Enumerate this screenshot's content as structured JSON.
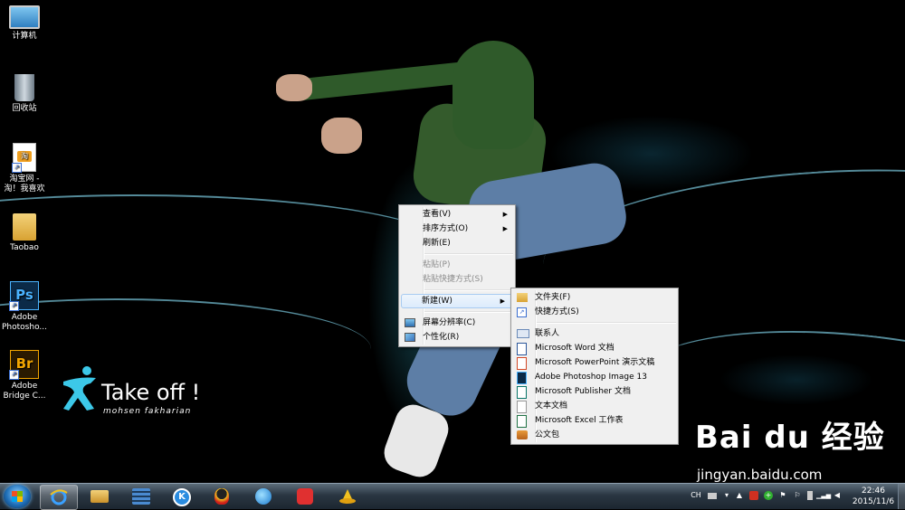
{
  "desktop_icons": [
    {
      "label": "计算机",
      "icon": "computer-icon"
    },
    {
      "label": "回收站",
      "icon": "recycle-bin-icon"
    },
    {
      "label": "淘宝网 - 淘！我喜欢",
      "icon": "taobao-shortcut-icon",
      "badge": "淘"
    },
    {
      "label": "Taobao",
      "icon": "folder-icon"
    },
    {
      "label": "Adobe Photosho...",
      "icon": "photoshop-icon",
      "badge": "Ps"
    },
    {
      "label": "Adobe Bridge C...",
      "icon": "bridge-icon",
      "badge": "Br"
    }
  ],
  "logo": {
    "title": "Take off !",
    "subtitle": "mohsen fakharian"
  },
  "context_menu": {
    "view": "查看(V)",
    "sort": "排序方式(O)",
    "refresh": "刷新(E)",
    "paste": "粘贴(P)",
    "paste_shortcut": "粘贴快捷方式(S)",
    "new": "新建(W)",
    "screen_resolution": "屏幕分辨率(C)",
    "personalize": "个性化(R)"
  },
  "new_submenu": {
    "folder": "文件夹(F)",
    "shortcut": "快捷方式(S)",
    "contact": "联系人",
    "word": "Microsoft Word 文档",
    "powerpoint": "Microsoft PowerPoint 演示文稿",
    "photoshop": "Adobe Photoshop Image 13",
    "publisher": "Microsoft Publisher 文档",
    "text": "文本文档",
    "excel": "Microsoft Excel 工作表",
    "briefcase": "公文包"
  },
  "taskbar": {
    "pinned": [
      "internet-explorer-icon",
      "file-explorer-icon",
      "media-player-icon",
      "kugou-icon",
      "qq-icon",
      "browser-icon",
      "game-icon",
      "wizard-hat-icon"
    ],
    "tray_language": "CH",
    "clock_time": "22:46",
    "clock_date": "2015/11/6"
  },
  "watermark": {
    "brand": "Bai du 经验",
    "url": "jingyan.baidu.com"
  },
  "colors": {
    "menu_bg": "#f0f0f0",
    "menu_highlight": "#dcebfc",
    "taskbar": "#2a3642"
  }
}
